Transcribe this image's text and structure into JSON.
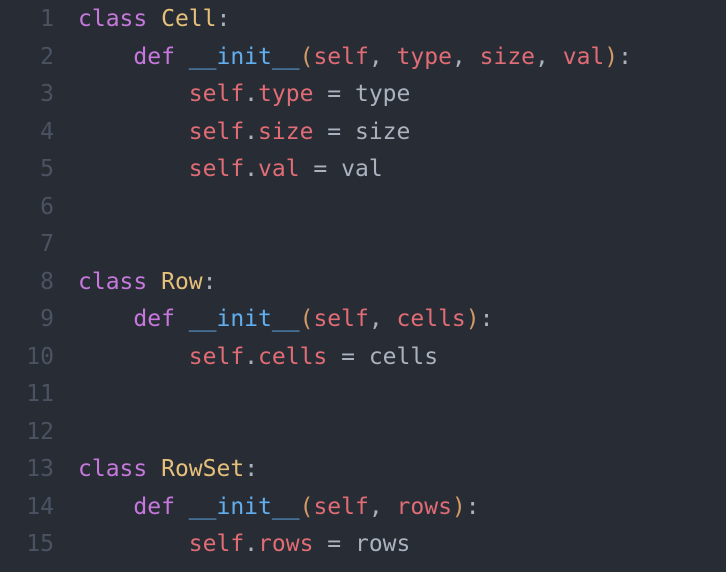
{
  "lines": [
    {
      "num": "1",
      "tokens": [
        [
          "kw",
          "class"
        ],
        [
          "punct",
          " "
        ],
        [
          "cls",
          "Cell"
        ],
        [
          "punct",
          ":"
        ]
      ]
    },
    {
      "num": "2",
      "tokens": [
        [
          "punct",
          "    "
        ],
        [
          "kw",
          "def"
        ],
        [
          "punct",
          " "
        ],
        [
          "fn",
          "__init__"
        ],
        [
          "paren",
          "("
        ],
        [
          "selfc",
          "self"
        ],
        [
          "punct",
          ", "
        ],
        [
          "selfc",
          "type"
        ],
        [
          "punct",
          ", "
        ],
        [
          "selfc",
          "size"
        ],
        [
          "punct",
          ", "
        ],
        [
          "selfc",
          "val"
        ],
        [
          "paren",
          ")"
        ],
        [
          "punct",
          ":"
        ]
      ]
    },
    {
      "num": "3",
      "tokens": [
        [
          "punct",
          "        "
        ],
        [
          "selfc",
          "self"
        ],
        [
          "punct",
          "."
        ],
        [
          "selfc",
          "type"
        ],
        [
          "punct",
          " = "
        ],
        [
          "param",
          "type"
        ]
      ]
    },
    {
      "num": "4",
      "tokens": [
        [
          "punct",
          "        "
        ],
        [
          "selfc",
          "self"
        ],
        [
          "punct",
          "."
        ],
        [
          "selfc",
          "size"
        ],
        [
          "punct",
          " = "
        ],
        [
          "param",
          "size"
        ]
      ]
    },
    {
      "num": "5",
      "tokens": [
        [
          "punct",
          "        "
        ],
        [
          "selfc",
          "self"
        ],
        [
          "punct",
          "."
        ],
        [
          "selfc",
          "val"
        ],
        [
          "punct",
          " = "
        ],
        [
          "param",
          "val"
        ]
      ]
    },
    {
      "num": "6",
      "tokens": []
    },
    {
      "num": "7",
      "tokens": []
    },
    {
      "num": "8",
      "tokens": [
        [
          "kw",
          "class"
        ],
        [
          "punct",
          " "
        ],
        [
          "cls",
          "Row"
        ],
        [
          "punct",
          ":"
        ]
      ]
    },
    {
      "num": "9",
      "tokens": [
        [
          "punct",
          "    "
        ],
        [
          "kw",
          "def"
        ],
        [
          "punct",
          " "
        ],
        [
          "fn",
          "__init__"
        ],
        [
          "paren",
          "("
        ],
        [
          "selfc",
          "self"
        ],
        [
          "punct",
          ", "
        ],
        [
          "selfc",
          "cells"
        ],
        [
          "paren",
          ")"
        ],
        [
          "punct",
          ":"
        ]
      ]
    },
    {
      "num": "10",
      "tokens": [
        [
          "punct",
          "        "
        ],
        [
          "selfc",
          "self"
        ],
        [
          "punct",
          "."
        ],
        [
          "selfc",
          "cells"
        ],
        [
          "punct",
          " = "
        ],
        [
          "param",
          "cells"
        ]
      ]
    },
    {
      "num": "11",
      "tokens": []
    },
    {
      "num": "12",
      "tokens": []
    },
    {
      "num": "13",
      "tokens": [
        [
          "kw",
          "class"
        ],
        [
          "punct",
          " "
        ],
        [
          "cls",
          "RowSet"
        ],
        [
          "punct",
          ":"
        ]
      ]
    },
    {
      "num": "14",
      "tokens": [
        [
          "punct",
          "    "
        ],
        [
          "kw",
          "def"
        ],
        [
          "punct",
          " "
        ],
        [
          "fn",
          "__init__"
        ],
        [
          "paren",
          "("
        ],
        [
          "selfc",
          "self"
        ],
        [
          "punct",
          ", "
        ],
        [
          "selfc",
          "rows"
        ],
        [
          "paren",
          ")"
        ],
        [
          "punct",
          ":"
        ]
      ]
    },
    {
      "num": "15",
      "tokens": [
        [
          "punct",
          "        "
        ],
        [
          "selfc",
          "self"
        ],
        [
          "punct",
          "."
        ],
        [
          "selfc",
          "rows"
        ],
        [
          "punct",
          " = "
        ],
        [
          "param",
          "rows"
        ]
      ]
    }
  ]
}
